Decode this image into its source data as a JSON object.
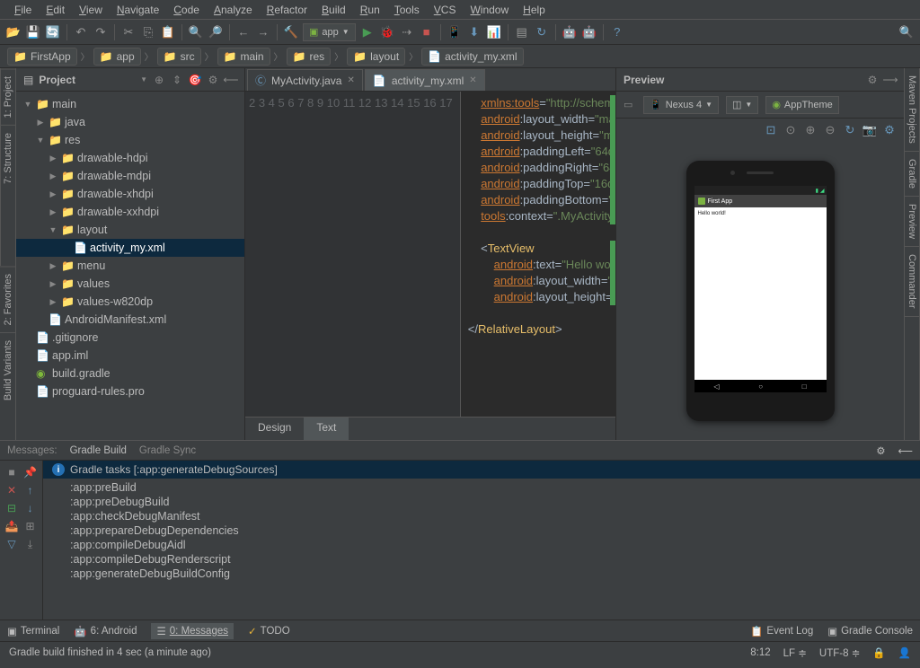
{
  "menu": [
    "File",
    "Edit",
    "View",
    "Navigate",
    "Code",
    "Analyze",
    "Refactor",
    "Build",
    "Run",
    "Tools",
    "VCS",
    "Window",
    "Help"
  ],
  "run_config": "app",
  "breadcrumb": [
    "FirstApp",
    "app",
    "src",
    "main",
    "res",
    "layout",
    "activity_my.xml"
  ],
  "project_panel_title": "Project",
  "tree": [
    {
      "d": 0,
      "tw": "▼",
      "icon": "📁",
      "cls": "folder-ico",
      "label": "main"
    },
    {
      "d": 1,
      "tw": "▶",
      "icon": "📁",
      "cls": "folder-ico",
      "label": "java"
    },
    {
      "d": 1,
      "tw": "▼",
      "icon": "📁",
      "cls": "folder-ico",
      "label": "res"
    },
    {
      "d": 2,
      "tw": "▶",
      "icon": "📁",
      "cls": "folder-ico",
      "label": "drawable-hdpi"
    },
    {
      "d": 2,
      "tw": "▶",
      "icon": "📁",
      "cls": "folder-ico",
      "label": "drawable-mdpi"
    },
    {
      "d": 2,
      "tw": "▶",
      "icon": "📁",
      "cls": "folder-ico",
      "label": "drawable-xhdpi"
    },
    {
      "d": 2,
      "tw": "▶",
      "icon": "📁",
      "cls": "folder-ico",
      "label": "drawable-xxhdpi"
    },
    {
      "d": 2,
      "tw": "▼",
      "icon": "📁",
      "cls": "folder-ico",
      "label": "layout"
    },
    {
      "d": 3,
      "tw": "",
      "icon": "📄",
      "cls": "file-ico",
      "label": "activity_my.xml",
      "sel": true
    },
    {
      "d": 2,
      "tw": "▶",
      "icon": "📁",
      "cls": "folder-ico",
      "label": "menu"
    },
    {
      "d": 2,
      "tw": "▶",
      "icon": "📁",
      "cls": "folder-ico",
      "label": "values"
    },
    {
      "d": 2,
      "tw": "▶",
      "icon": "📁",
      "cls": "folder-ico",
      "label": "values-w820dp"
    },
    {
      "d": 1,
      "tw": "",
      "icon": "📄",
      "cls": "file-ico",
      "label": "AndroidManifest.xml"
    },
    {
      "d": 0,
      "tw": "",
      "icon": "📄",
      "cls": "file-ico",
      "label": ".gitignore",
      "off": -1
    },
    {
      "d": 0,
      "tw": "",
      "icon": "📄",
      "cls": "file-ico",
      "label": "app.iml",
      "off": -1
    },
    {
      "d": 0,
      "tw": "",
      "icon": "◉",
      "cls": "gradle-ico",
      "label": "build.gradle",
      "off": -1
    },
    {
      "d": 0,
      "tw": "",
      "icon": "📄",
      "cls": "file-ico",
      "label": "proguard-rules.pro",
      "off": -1
    }
  ],
  "editor_tabs": [
    {
      "icon": "Ⓒ",
      "label": "MyActivity.java",
      "active": false
    },
    {
      "icon": "📄",
      "label": "activity_my.xml",
      "active": true
    }
  ],
  "line_start": 2,
  "line_end": 17,
  "mode_tabs": {
    "design": "Design",
    "text": "Text"
  },
  "preview_title": "Preview",
  "device": "Nexus 4",
  "theme": "AppTheme",
  "app_title": "First App",
  "app_body": "Hello world!",
  "left_tabs": [
    "1: Project",
    "7: Structure"
  ],
  "left_tabs2": [
    "2: Favorites",
    "Build Variants"
  ],
  "right_tabs": [
    "Maven Projects",
    "Gradle",
    "Preview",
    "Commander"
  ],
  "msg_tabs": {
    "messages": "Messages:",
    "gradle_build": "Gradle Build",
    "gradle_sync": "Gradle Sync"
  },
  "msg_task": "Gradle tasks [:app:generateDebugSources]",
  "msg_lines": [
    ":app:preBuild",
    ":app:preDebugBuild",
    ":app:checkDebugManifest",
    ":app:prepareDebugDependencies",
    ":app:compileDebugAidl",
    ":app:compileDebugRenderscript",
    ":app:generateDebugBuildConfig"
  ],
  "btm_tabs": {
    "terminal": "Terminal",
    "android": "6: Android",
    "messages": "0: Messages",
    "todo": "TODO",
    "event_log": "Event Log",
    "gradle_console": "Gradle Console"
  },
  "status_msg": "Gradle build finished in 4 sec (a minute ago)",
  "status_cursor": "8:12",
  "status_le": "LF",
  "status_enc": "UTF-8",
  "status_lock": "⤢"
}
